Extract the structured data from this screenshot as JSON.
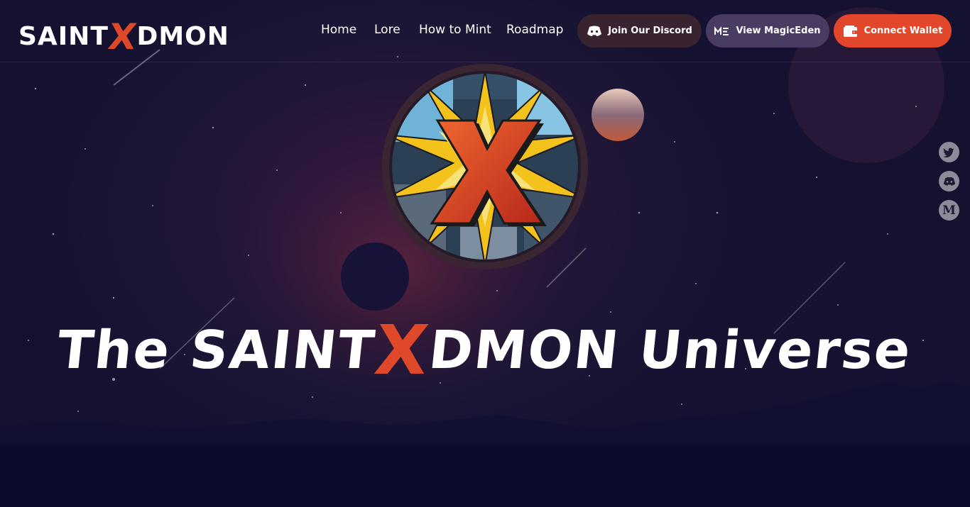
{
  "brand": {
    "prefix": "SAINT",
    "x": "X",
    "suffix": "DMON"
  },
  "nav": {
    "home": "Home",
    "lore": "Lore",
    "how_to_mint": "How to Mint",
    "roadmap": "Roadmap"
  },
  "buttons": {
    "discord": "Join Our Discord",
    "magic_eden": "View MagicEden",
    "wallet": "Connect Wallet"
  },
  "hero": {
    "title_prefix": "The SAINT",
    "title_x": "X",
    "title_suffix": "DMON Universe"
  },
  "social": {
    "medium_letter": "M"
  },
  "colors": {
    "accent": "#e2472b",
    "bg": "#1a1535",
    "discord_pill": "#3a2330",
    "magic_pill": "#4a3b63"
  }
}
